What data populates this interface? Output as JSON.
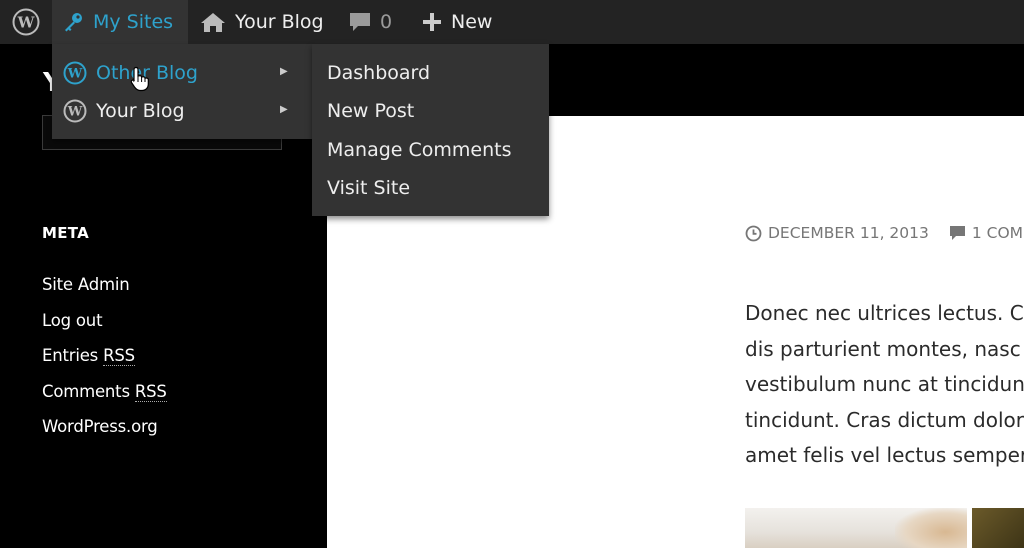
{
  "adminbar": {
    "wp_icon": "wordpress-logo-icon",
    "my_sites": {
      "icon": "key-icon",
      "label": "My Sites"
    },
    "your_blog": {
      "icon": "home-icon",
      "label": "Your Blog"
    },
    "comments": {
      "icon": "speech-bubble-icon",
      "count": "0"
    },
    "new": {
      "icon": "plus-icon",
      "label": "New"
    }
  },
  "my_sites_menu": {
    "items": [
      {
        "label": "Other Blog",
        "icon": "wordpress-logo-icon",
        "state": "hovered"
      },
      {
        "label": "Your Blog",
        "icon": "wordpress-logo-icon"
      }
    ],
    "submenu": [
      {
        "label": "Dashboard"
      },
      {
        "label": "New Post"
      },
      {
        "label": "Manage Comments"
      },
      {
        "label": "Visit Site"
      }
    ]
  },
  "sidebar": {
    "title_fragment": "Y",
    "meta_heading": "META",
    "meta_links": [
      {
        "label": "Site Admin"
      },
      {
        "label": "Log out"
      },
      {
        "prefix": "Entries ",
        "abbr": "RSS"
      },
      {
        "prefix": "Comments ",
        "abbr": "RSS"
      },
      {
        "label": "WordPress.org"
      }
    ]
  },
  "post": {
    "date": "DECEMBER 11, 2013",
    "comments_link": "1 COM",
    "lines": [
      "Donec nec ultrices lectus. C",
      "dis parturient montes, nasc",
      "vestibulum nunc at tincidun",
      "tincidunt. Cras dictum dolor",
      "amet felis vel lectus semper"
    ]
  },
  "colors": {
    "adminbar_bg": "#232323",
    "menu_bg": "#333333",
    "accent": "#2ea2cc",
    "meta_text": "#767676"
  }
}
